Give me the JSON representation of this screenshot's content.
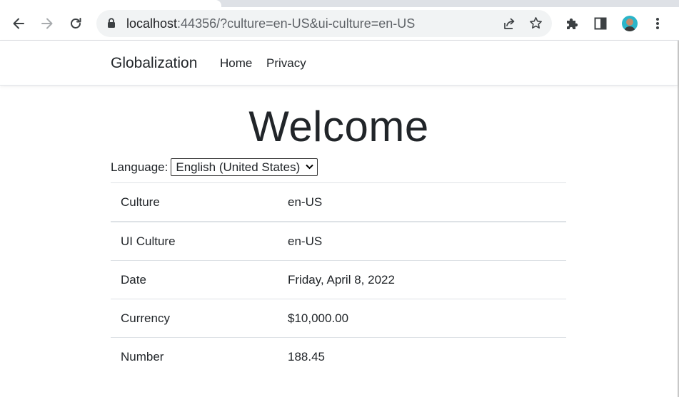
{
  "browser": {
    "url_host": "localhost",
    "url_rest": ":44356/?culture=en-US&ui-culture=en-US"
  },
  "navbar": {
    "brand": "Globalization",
    "links": [
      "Home",
      "Privacy"
    ]
  },
  "main": {
    "heading": "Welcome",
    "language_label": "Language:",
    "language_selected": "English (United States)",
    "rows": [
      {
        "key": "Culture",
        "value": "en-US"
      },
      {
        "key": "UI Culture",
        "value": "en-US"
      },
      {
        "key": "Date",
        "value": "Friday, April 8, 2022"
      },
      {
        "key": "Currency",
        "value": "$10,000.00"
      },
      {
        "key": "Number",
        "value": "188.45"
      }
    ]
  },
  "icons": {
    "back": "arrow-left-icon",
    "forward": "arrow-right-icon",
    "reload": "reload-icon",
    "lock": "lock-icon",
    "share": "share-icon",
    "bookmark": "star-icon",
    "extensions": "puzzle-icon",
    "side_panel": "side-panel-icon",
    "menu": "kebab-menu-icon"
  },
  "colors": {
    "omnibox_bg": "#f1f3f4",
    "text": "#212529",
    "icon": "#5f6368",
    "avatar_bg": "#2bb5c9"
  }
}
